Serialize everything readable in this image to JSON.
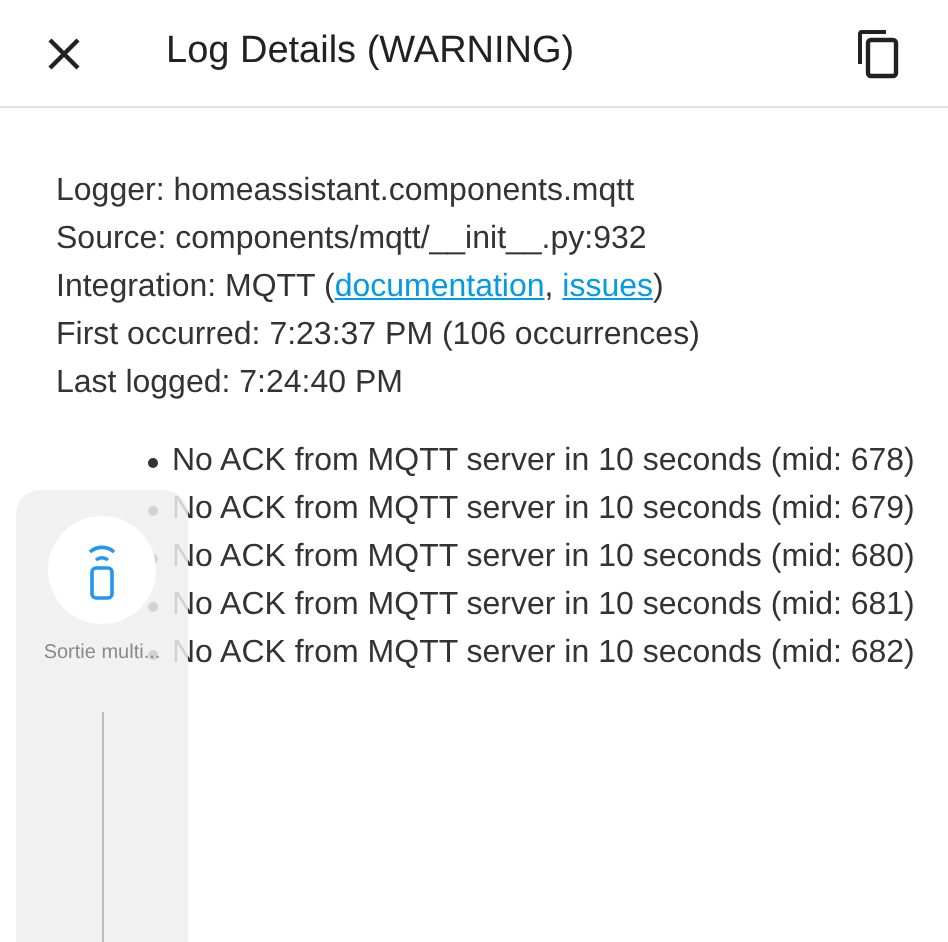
{
  "dialog": {
    "title": "Log Details (WARNING)"
  },
  "details": [
    {
      "kind": "text",
      "text": "Logger: homeassistant.components.mqtt"
    },
    {
      "kind": "text",
      "text": "Source: components/mqtt/__init__.py:932"
    },
    {
      "kind": "links",
      "text": "Integration: MQTT (",
      "links": [
        "documentation",
        "issues"
      ],
      "separator": ", ",
      "suffix": ")"
    },
    {
      "kind": "text",
      "text": "First occurred: 7:23:37 PM (106 occurrences)"
    },
    {
      "kind": "text",
      "text": "Last logged: 7:24:40 PM"
    }
  ],
  "messages": [
    "No ACK from MQTT server in 10 seconds (mid: 678)",
    "No ACK from MQTT server in 10 seconds (mid: 679)",
    "No ACK from MQTT server in 10 seconds (mid: 680)",
    "No ACK from MQTT server in 10 seconds (mid: 681)",
    "No ACK from MQTT server in 10 seconds (mid: 682)"
  ],
  "overlay_card": {
    "label": "Sortie multi..."
  }
}
